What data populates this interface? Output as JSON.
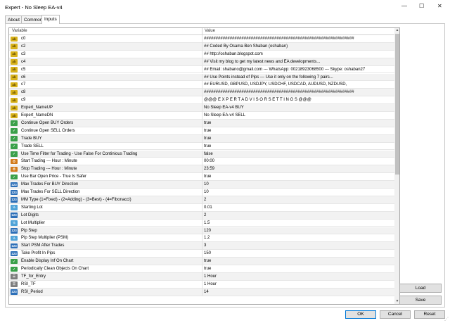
{
  "window": {
    "title": "Expert - No Sleep EA-v4",
    "minimize": "—",
    "maximize": "☐",
    "close": "✕"
  },
  "tabs": [
    {
      "label": "About"
    },
    {
      "label": "Common"
    },
    {
      "label": "Inputs"
    }
  ],
  "grid": {
    "col_variable": "Variable",
    "col_value": "Value",
    "rows": [
      {
        "icon": "ab",
        "name": "c0",
        "value": "################################################################"
      },
      {
        "icon": "ab",
        "name": "c2",
        "value": "##      Coded By Osama Ben Shaban (oshaban)"
      },
      {
        "icon": "ab",
        "name": "c3",
        "value": "##      http://oshaban.blogspot.com"
      },
      {
        "icon": "ab",
        "name": "c4",
        "value": "##      Visit my blog to get my latest news and EA developments..."
      },
      {
        "icon": "ab",
        "name": "c5",
        "value": "##      Email: shabano@gmail.com --- WhatsApp: 00218923068500 --- Skype: oshaban27"
      },
      {
        "icon": "ab",
        "name": "c6",
        "value": "##      Use Points instead of Pips --- Use it only on the following 7 pairs..."
      },
      {
        "icon": "ab",
        "name": "c7",
        "value": "##      EURUSD, GBPUSD, USDJPY, USDCHF, USDCAD, AUDUSD, NZDUSD,"
      },
      {
        "icon": "ab",
        "name": "c8",
        "value": "################################################################"
      },
      {
        "icon": "ab",
        "name": "c9",
        "value": "@@@ E X P E R T   A D V I S O R   S E T T I N G S @@@"
      },
      {
        "icon": "ab",
        "name": "Expert_NameUP",
        "value": "No Sleep EA-v4 BUY"
      },
      {
        "icon": "ab",
        "name": "Expert_NameDN",
        "value": "No Sleep EA-v4 SELL"
      },
      {
        "icon": "bool",
        "name": "Continue Open BUY Orders",
        "value": "true"
      },
      {
        "icon": "bool",
        "name": "Continue Open SELL Orders",
        "value": "true"
      },
      {
        "icon": "bool",
        "name": "Trade BUY",
        "value": "true"
      },
      {
        "icon": "bool",
        "name": "Trade SELL",
        "value": "true"
      },
      {
        "icon": "bool",
        "name": "Use Time Filter for Trading - Use False For Continious Trading",
        "value": "false"
      },
      {
        "icon": "time",
        "name": "Start Trading --- Hour : Minute",
        "value": "00:00"
      },
      {
        "icon": "time",
        "name": "Stop Trading --- Hour : Minute",
        "value": "23:59"
      },
      {
        "icon": "bool",
        "name": "Use Bar Open Price - True Is Safer",
        "value": "true"
      },
      {
        "icon": "int",
        "name": "Max Trades For BUY Direction",
        "value": "10"
      },
      {
        "icon": "int",
        "name": "Max Trades For SELL Direction",
        "value": "10"
      },
      {
        "icon": "int",
        "name": "MM Type (1=Fixed) - (2=Adding) - (3=Best) - (4=Fibonacci)",
        "value": "2"
      },
      {
        "icon": "dbl",
        "name": "Starting Lot",
        "value": "0.01"
      },
      {
        "icon": "int",
        "name": "Lot Digits",
        "value": "2"
      },
      {
        "icon": "dbl",
        "name": "Lot Multiplier",
        "value": "1.5"
      },
      {
        "icon": "int",
        "name": "Pip Step",
        "value": "120"
      },
      {
        "icon": "dbl",
        "name": "Pip Step Multiplier (PSM)",
        "value": "1.2"
      },
      {
        "icon": "int",
        "name": "Start PSM After Trades",
        "value": "3"
      },
      {
        "icon": "int",
        "name": "Take Profit In Pips",
        "value": "150"
      },
      {
        "icon": "bool",
        "name": "Enable Display Inf On Chart",
        "value": "true"
      },
      {
        "icon": "bool",
        "name": "Periodically Clean Objects On Chart",
        "value": "true"
      },
      {
        "icon": "list",
        "name": "TF_for_Entry",
        "value": "1 Hour"
      },
      {
        "icon": "list",
        "name": "RSI_TF",
        "value": "1 Hour"
      },
      {
        "icon": "int",
        "name": "RSI_Period",
        "value": "14"
      }
    ]
  },
  "icon_labels": {
    "ab": "ab",
    "bool": "✓",
    "int": "123",
    "dbl": "½",
    "time": "⏱",
    "list": "☰"
  },
  "side_buttons": {
    "load": "Load",
    "save": "Save"
  },
  "bottom_buttons": {
    "ok": "OK",
    "cancel": "Cancel",
    "reset": "Reset"
  },
  "colors": {
    "accent": "#0078d7"
  }
}
